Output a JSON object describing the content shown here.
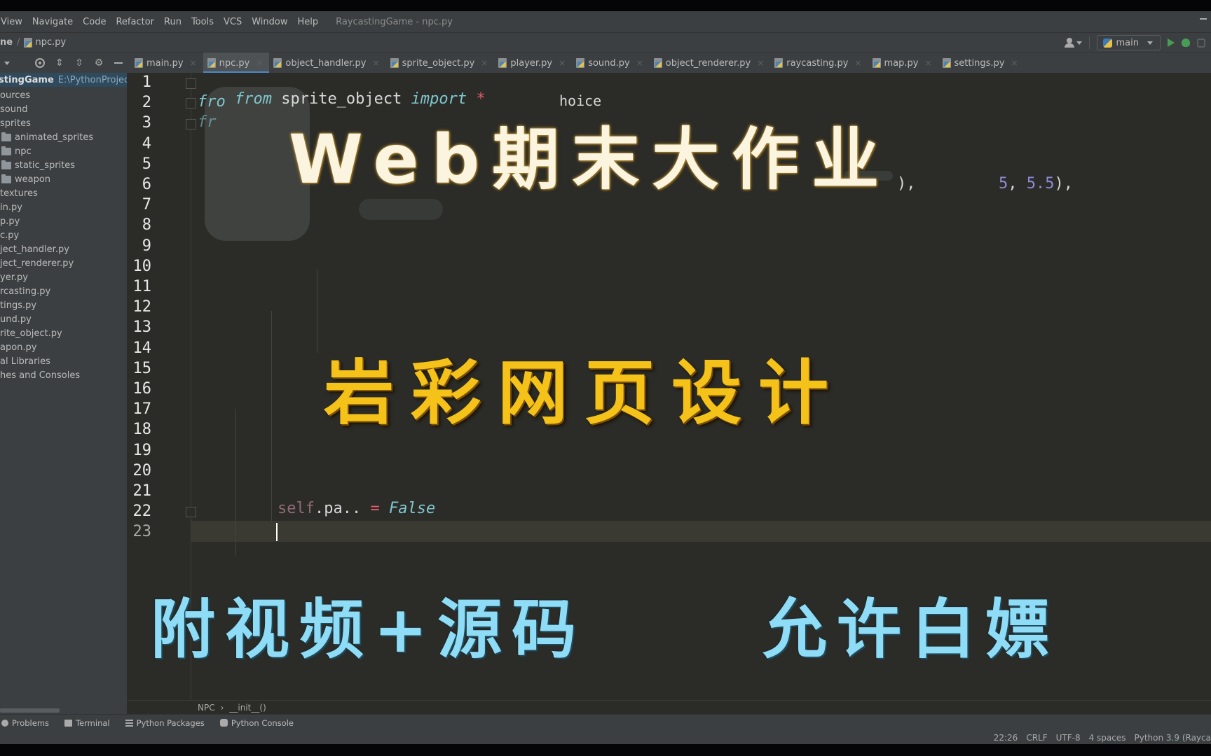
{
  "menu": {
    "items": [
      "View",
      "Navigate",
      "Code",
      "Refactor",
      "Run",
      "Tools",
      "VCS",
      "Window",
      "Help"
    ],
    "window_title": "RaycastingGame - npc.py"
  },
  "navbar": {
    "root_crumb": "ne",
    "file_crumb": "npc.py",
    "run_config": "main"
  },
  "tabs": [
    {
      "label": "main.py",
      "active": false
    },
    {
      "label": "npc.py",
      "active": true
    },
    {
      "label": "object_handler.py",
      "active": false
    },
    {
      "label": "sprite_object.py",
      "active": false
    },
    {
      "label": "player.py",
      "active": false
    },
    {
      "label": "sound.py",
      "active": false
    },
    {
      "label": "object_renderer.py",
      "active": false
    },
    {
      "label": "raycasting.py",
      "active": false
    },
    {
      "label": "map.py",
      "active": false
    },
    {
      "label": "settings.py",
      "active": false
    }
  ],
  "project": {
    "root_name": "stingGame",
    "root_path": "E:\\PythonProjects\\",
    "tree": [
      {
        "label": "ources",
        "folder": false,
        "indent": 0
      },
      {
        "label": "sound",
        "folder": false,
        "indent": 0
      },
      {
        "label": "sprites",
        "folder": false,
        "indent": 0
      },
      {
        "label": "animated_sprites",
        "folder": true,
        "indent": 1
      },
      {
        "label": "npc",
        "folder": true,
        "indent": 1
      },
      {
        "label": "static_sprites",
        "folder": true,
        "indent": 1
      },
      {
        "label": "weapon",
        "folder": true,
        "indent": 1
      },
      {
        "label": "textures",
        "folder": false,
        "indent": 0
      },
      {
        "label": "in.py",
        "folder": false,
        "indent": 0
      },
      {
        "label": "p.py",
        "folder": false,
        "indent": 0
      },
      {
        "label": "c.py",
        "folder": false,
        "indent": 0
      },
      {
        "label": "ject_handler.py",
        "folder": false,
        "indent": 0
      },
      {
        "label": "ject_renderer.py",
        "folder": false,
        "indent": 0
      },
      {
        "label": "yer.py",
        "folder": false,
        "indent": 0
      },
      {
        "label": "rcasting.py",
        "folder": false,
        "indent": 0
      },
      {
        "label": "tings.py",
        "folder": false,
        "indent": 0
      },
      {
        "label": "und.py",
        "folder": false,
        "indent": 0
      },
      {
        "label": "rite_object.py",
        "folder": false,
        "indent": 0
      },
      {
        "label": "apon.py",
        "folder": false,
        "indent": 0
      },
      {
        "label": "al Libraries",
        "folder": false,
        "indent": 0
      },
      {
        "label": "hes and Consoles",
        "folder": false,
        "indent": 0
      }
    ]
  },
  "editor": {
    "line_numbers": [
      "1",
      "2",
      "3",
      "4",
      "5",
      "6",
      "7",
      "8",
      "9",
      "10",
      "11",
      "12",
      "13",
      "14",
      "15",
      "16",
      "17",
      "18",
      "19",
      "20",
      "21",
      "22",
      "23"
    ],
    "line1": {
      "kw1": "from",
      "text": " sprite_object ",
      "kw2": "import",
      "star": " *"
    },
    "line2_kw": "fro",
    "line3_kw": "fr",
    "choice_fragment": "hoice",
    "line6_fragment_a": "),",
    "line6_num_a": "5",
    "line6_sep": ", ",
    "line6_num_b": "5.5",
    "line6_tail": "),",
    "line22": {
      "self": "self",
      "attr": ".pa..",
      "op": " = ",
      "value": "False"
    }
  },
  "overlay": {
    "title": "Web期末大作业",
    "brand": "岩彩网页设计",
    "left_note": "附视频+源码",
    "right_note": "允许白嫖"
  },
  "breadcrumb": {
    "class_name": "NPC",
    "separator": "›",
    "method": "__init__()"
  },
  "tool_windows": [
    {
      "label": "Problems",
      "icon": "problems-icon"
    },
    {
      "label": "Terminal",
      "icon": "terminal-icon"
    },
    {
      "label": "Python Packages",
      "icon": "packages-icon"
    },
    {
      "label": "Python Console",
      "icon": "python-console-icon"
    }
  ],
  "status": {
    "position": "22:26",
    "line_sep": "CRLF",
    "encoding": "UTF-8",
    "indent": "4 spaces",
    "interpreter": "Python 3.9 (Rayca"
  }
}
